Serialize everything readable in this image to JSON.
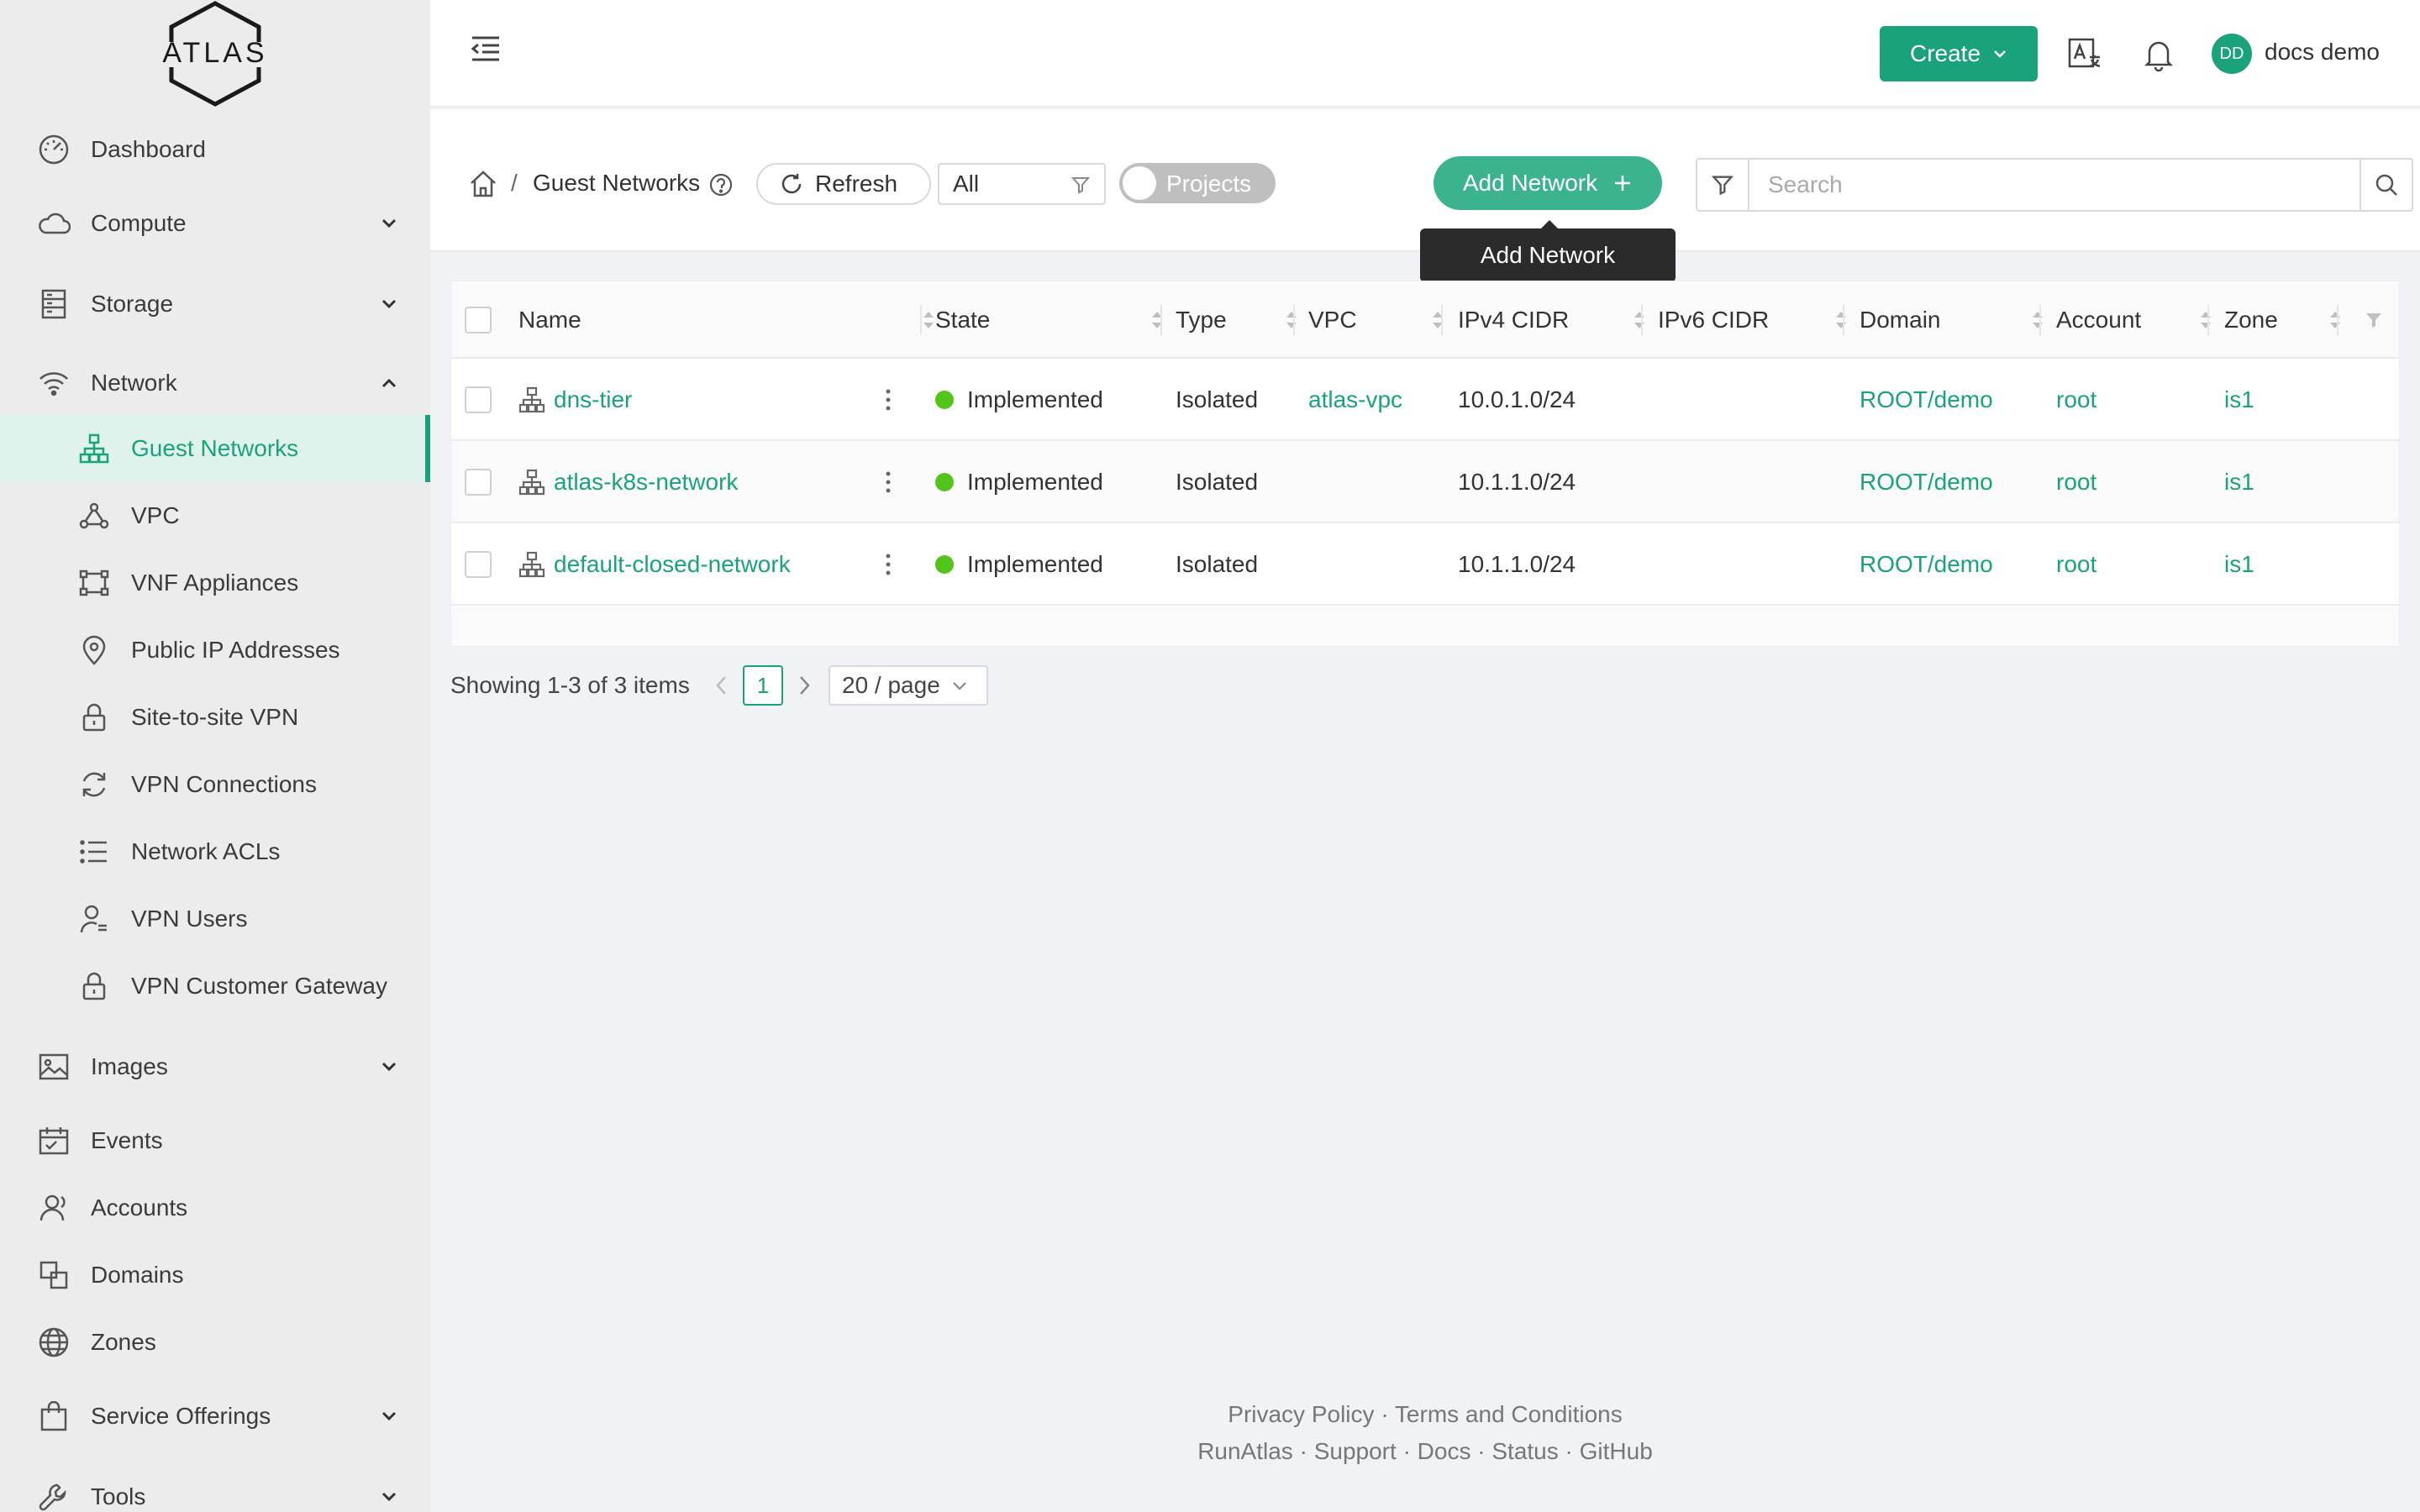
{
  "brand": {
    "logo_text": "ATLAS"
  },
  "sidebar": {
    "items": [
      {
        "label": "Dashboard"
      },
      {
        "label": "Compute"
      },
      {
        "label": "Storage"
      },
      {
        "label": "Network"
      },
      {
        "label": "Guest Networks"
      },
      {
        "label": "VPC"
      },
      {
        "label": "VNF Appliances"
      },
      {
        "label": "Public IP Addresses"
      },
      {
        "label": "Site-to-site VPN"
      },
      {
        "label": "VPN Connections"
      },
      {
        "label": "Network ACLs"
      },
      {
        "label": "VPN Users"
      },
      {
        "label": "VPN Customer Gateway"
      },
      {
        "label": "Images"
      },
      {
        "label": "Events"
      },
      {
        "label": "Accounts"
      },
      {
        "label": "Domains"
      },
      {
        "label": "Zones"
      },
      {
        "label": "Service Offerings"
      },
      {
        "label": "Tools"
      }
    ],
    "active_item": "Guest Networks"
  },
  "header": {
    "create_label": "Create",
    "user_initials": "DD",
    "user_name": "docs demo"
  },
  "toolbar": {
    "breadcrumb_sep": "/",
    "page_title": "Guest Networks",
    "refresh_label": "Refresh",
    "filter_value": "All",
    "projects_label": "Projects",
    "add_label": "Add Network",
    "tooltip": "Add Network",
    "search_placeholder": "Search"
  },
  "table": {
    "columns": [
      "Name",
      "State",
      "Type",
      "VPC",
      "IPv4 CIDR",
      "IPv6 CIDR",
      "Domain",
      "Account",
      "Zone"
    ],
    "rows": [
      {
        "name": "dns-tier",
        "state": "Implemented",
        "type": "Isolated",
        "vpc": "atlas-vpc",
        "ipv4": "10.0.1.0/24",
        "ipv6": "",
        "domain": "ROOT/demo",
        "account": "root",
        "zone": "is1"
      },
      {
        "name": "atlas-k8s-network",
        "state": "Implemented",
        "type": "Isolated",
        "vpc": "",
        "ipv4": "10.1.1.0/24",
        "ipv6": "",
        "domain": "ROOT/demo",
        "account": "root",
        "zone": "is1"
      },
      {
        "name": "default-closed-network",
        "state": "Implemented",
        "type": "Isolated",
        "vpc": "",
        "ipv4": "10.1.1.0/24",
        "ipv6": "",
        "domain": "ROOT/demo",
        "account": "root",
        "zone": "is1"
      }
    ],
    "state_color": "#52c41a"
  },
  "pagination": {
    "summary": "Showing 1-3 of 3 items",
    "current_page": "1",
    "page_size": "20 / page"
  },
  "footer": {
    "line1": [
      "Privacy Policy",
      "Terms and Conditions"
    ],
    "line2": [
      "RunAtlas",
      "Support",
      "Docs",
      "Status",
      "GitHub"
    ],
    "sep": "·"
  },
  "colors": {
    "accent": "#1aa37a",
    "sidebar_bg": "#ececec",
    "active_bg": "#dff3ec"
  }
}
